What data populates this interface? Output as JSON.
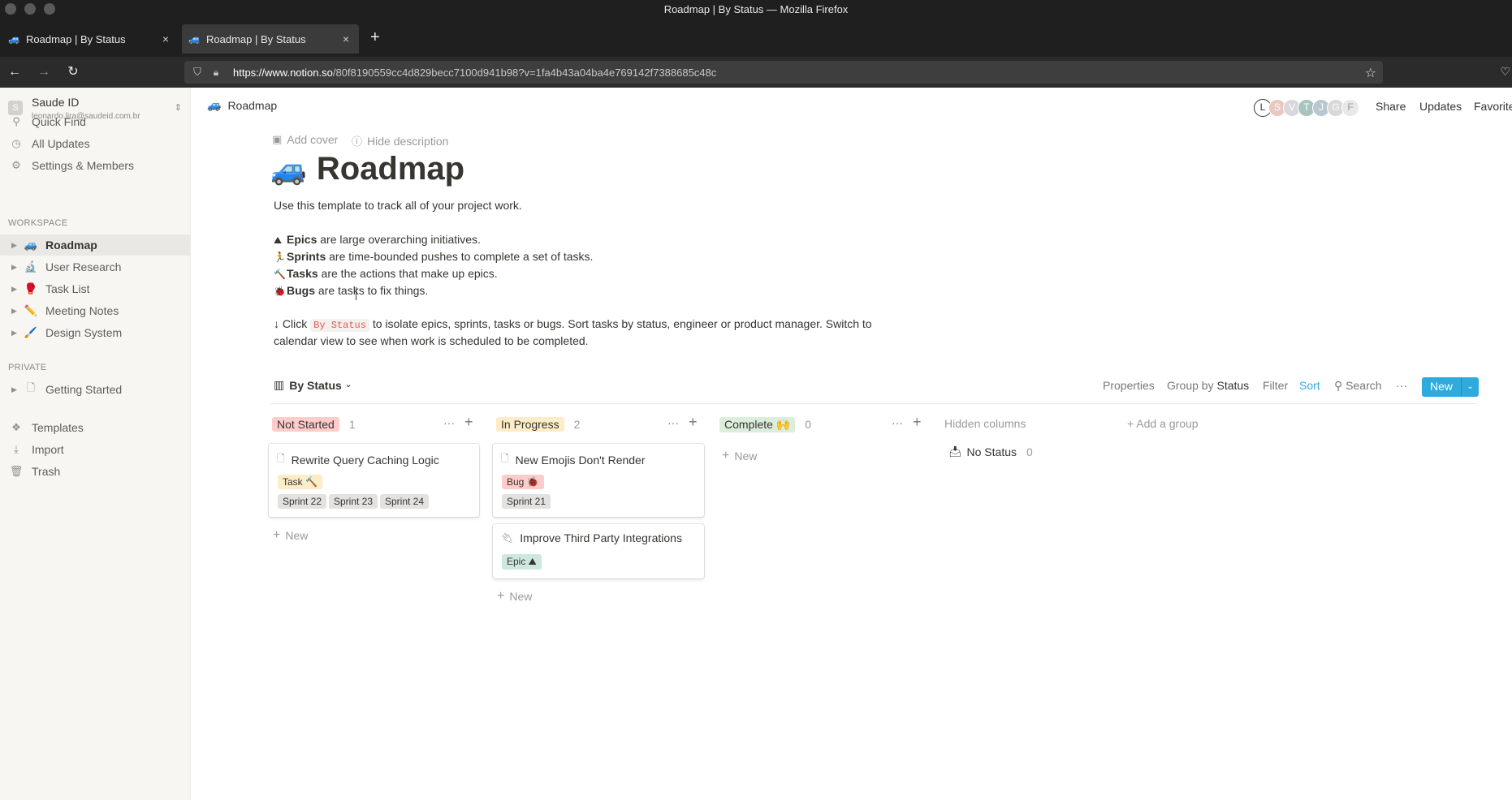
{
  "browser": {
    "window_title": "Roadmap | By Status — Mozilla Firefox",
    "tabs": [
      {
        "label": "Roadmap | By Status",
        "close": "×",
        "favicon": "car-icon"
      },
      {
        "label": "Roadmap | By Status",
        "close": "×",
        "favicon": "car-icon"
      }
    ],
    "new_tab": "+",
    "url_host": "https://www.notion.so",
    "url_path": "/80f8190559cc4d829becc7100d941b98?v=1fa4b43a04ba4e769142f7388685c48c"
  },
  "sidebar": {
    "workspace_avatar": "S",
    "workspace_name": "Saude ID",
    "workspace_email": "leonardo.lira@saudeid.com.br",
    "top_items": [
      {
        "label": "Quick Find",
        "icon": "search-icon"
      },
      {
        "label": "All Updates",
        "icon": "clock-icon"
      },
      {
        "label": "Settings & Members",
        "icon": "gear-icon"
      }
    ],
    "workspace_section": "WORKSPACE",
    "workspace_pages": [
      {
        "label": "Roadmap",
        "icon": "🚙"
      },
      {
        "label": "User Research",
        "icon": "🔬"
      },
      {
        "label": "Task List",
        "icon": "🥊"
      },
      {
        "label": "Meeting Notes",
        "icon": "✏️"
      },
      {
        "label": "Design System",
        "icon": "🖌️"
      }
    ],
    "private_section": "PRIVATE",
    "private_pages": [
      {
        "label": "Getting Started",
        "icon": "page-icon"
      }
    ],
    "bottom_items": [
      {
        "label": "Templates",
        "icon": "templates-icon"
      },
      {
        "label": "Import",
        "icon": "download-icon"
      },
      {
        "label": "Trash",
        "icon": "trash-icon"
      }
    ]
  },
  "topbar": {
    "breadcrumb": "Roadmap",
    "breadcrumb_icon": "🚙",
    "faces": [
      "L",
      "S",
      "V",
      "T",
      "J",
      "G",
      "F"
    ],
    "share": "Share",
    "updates": "Updates",
    "favorite": "Favorite"
  },
  "page": {
    "add_cover": "Add cover",
    "hide_description": "Hide description",
    "title": "Roadmap",
    "title_icon": "🚙",
    "intro": "Use this template to track all of your project work.",
    "bullets": [
      {
        "icon": "⛰",
        "bold": "Epics",
        "rest": " are large overarching initiatives."
      },
      {
        "icon": "🏃",
        "bold": "Sprints",
        "rest": " are time-bounded pushes to complete a set of tasks."
      },
      {
        "icon": "🔨",
        "bold": "Tasks",
        "rest": " are the actions that make up epics."
      },
      {
        "icon": "🐞",
        "bold": "Bugs",
        "rest": " are tasks to fix things."
      }
    ],
    "click_prefix": "↓ Click ",
    "click_code": "By Status",
    "click_rest": " to isolate epics, sprints, tasks or bugs. Sort tasks by status, engineer or product manager. Switch to",
    "click_line2": "calendar view to see when work is scheduled to be completed."
  },
  "board": {
    "view_name": "By Status",
    "toolbar": {
      "properties": "Properties",
      "group_by_prefix": "Group by ",
      "group_by_value": "Status",
      "filter": "Filter",
      "sort": "Sort",
      "search": "Search",
      "more": "···",
      "new": "New",
      "new_dropdown": "⌄"
    },
    "columns": [
      {
        "name": "Not Started",
        "count": "1",
        "color": "#ffcccc",
        "cards": [
          {
            "title": "Rewrite Query Caching Logic",
            "tags": [
              {
                "label": "Task 🔨",
                "color": "#fdecc8"
              },
              {
                "label": "Sprint 22",
                "color": "#e3e2e0"
              },
              {
                "label": "Sprint 23",
                "color": "#e3e2e0"
              },
              {
                "label": "Sprint 24",
                "color": "#e3e2e0"
              }
            ]
          }
        ],
        "add_label": "New"
      },
      {
        "name": "In Progress",
        "count": "2",
        "color": "#fdecc8",
        "cards": [
          {
            "title": "New Emojis Don't Render",
            "tags": [
              {
                "label": "Bug 🐞",
                "color": "#ffcccc"
              },
              {
                "label": "Sprint 21",
                "color": "#e3e2e0"
              }
            ]
          },
          {
            "title": "Improve Third Party Integrations",
            "tags": [
              {
                "label": "Epic ⛰",
                "color": "#cce8e0"
              }
            ]
          }
        ],
        "add_label": "New"
      },
      {
        "name": "Complete 🙌",
        "count": "0",
        "color": "#dbeddb",
        "cards": [],
        "add_label": "New"
      }
    ],
    "hidden_columns": "Hidden columns",
    "no_status": "No Status",
    "no_status_count": "0",
    "add_group": "Add a group"
  }
}
